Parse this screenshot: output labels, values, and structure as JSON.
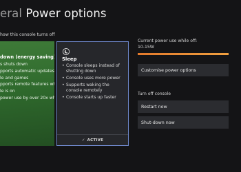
{
  "header": {
    "title_partial": "eral",
    "title_main": "Power options"
  },
  "subtitle": "how this console turns off",
  "energy_card": {
    "heading": "down (energy saving)",
    "items": [
      "s shuts down",
      "pports automatic updates of",
      "le and games",
      "pports remote features while",
      "le is on",
      "power use by over 20x while"
    ]
  },
  "sleep_card": {
    "icon": "moon-icon",
    "heading": "Sleep",
    "items": [
      "Console sleeps instead of shutting down",
      "Console uses more power",
      "Supports waking the console remotely",
      "Console starts up faster"
    ],
    "active_label": "ACTIVE"
  },
  "power_info": {
    "label": "Current power use while off:",
    "value": "10-15W",
    "bar_color": "#e8882f"
  },
  "customise_button": "Customise power options",
  "turn_off_label": "Turn off console",
  "restart_button": "Restart now",
  "shutdown_button": "Shut-down now",
  "colors": {
    "energy_green": "#3a7535",
    "selection_blue": "#6d86c8",
    "background": "#141416"
  }
}
